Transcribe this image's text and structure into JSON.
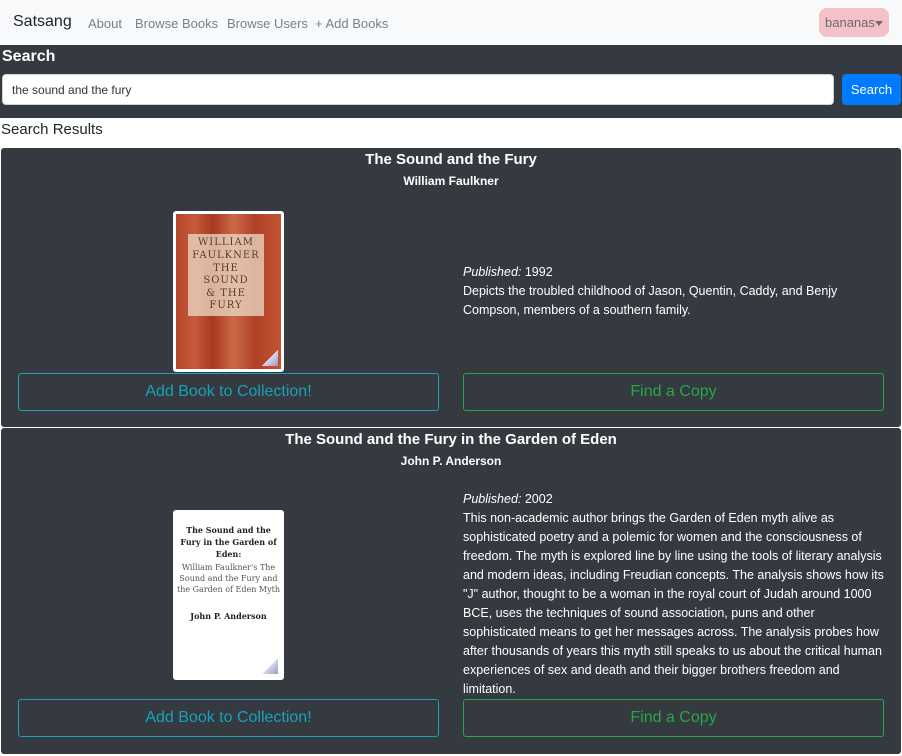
{
  "navbar": {
    "brand": "Satsang",
    "links": [
      "About",
      "Browse Books",
      "Browse Users",
      "+ Add Books"
    ],
    "user": "bananas"
  },
  "search": {
    "heading": "Search",
    "value": "the sound and the fury",
    "button": "Search"
  },
  "results": {
    "heading": "Search Results",
    "books": [
      {
        "title": "The Sound and the Fury",
        "author": "William Faulkner",
        "published_label": "Published:",
        "year": "1992",
        "description": "Depicts the troubled childhood of Jason, Quentin, Caddy, and Benjy Compson, members of a southern family.",
        "add_button": "Add Book to Collection!",
        "find_button": "Find a Copy",
        "cover_lines": [
          "WILLIAM",
          "FAULKNER",
          "THE SOUND",
          "& THE FURY"
        ]
      },
      {
        "title": "The Sound and the Fury in the Garden of Eden",
        "author": "John P. Anderson",
        "published_label": "Published:",
        "year": "2002",
        "description": "This non-academic author brings the Garden of Eden myth alive as sophisticated poetry and a polemic for women and the consciousness of freedom. The myth is explored line by line using the tools of literary analysis and modern ideas, including Freudian concepts. The analysis shows how its \"J\" author, thought to be a woman in the royal court of Judah around 1000 BCE, uses the techniques of sound association, puns and other sophisticated means to get her messages across. The analysis probes how after thousands of years this myth still speaks to us about the critical human experiences of sex and death and their bigger brothers freedom and limitation.",
        "add_button": "Add Book to Collection!",
        "find_button": "Find a Copy",
        "cover_title": "The Sound and the Fury in the Garden of Eden:",
        "cover_subtitle": "William Faulkner's The Sound and the Fury and the Garden of Eden Myth",
        "cover_author": "John P. Anderson"
      }
    ]
  }
}
